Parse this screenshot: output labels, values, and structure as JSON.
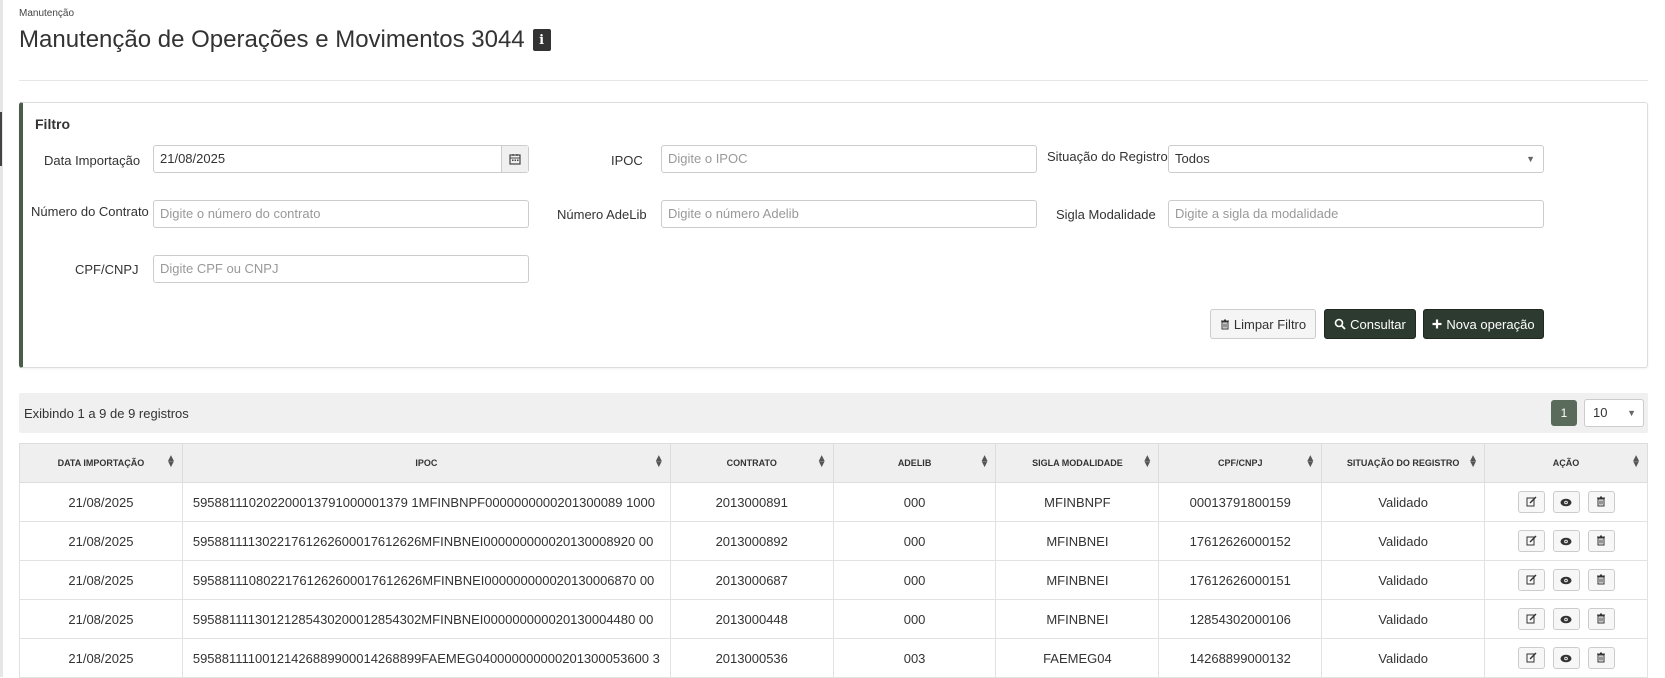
{
  "breadcrumb": "Manutenção",
  "title": "Manutenção de Operações e Movimentos 3044",
  "filter": {
    "heading": "Filtro",
    "data_importacao": {
      "label": "Data Importação",
      "value": "21/08/2025"
    },
    "ipoc": {
      "label": "IPOC",
      "placeholder": "Digite o IPOC"
    },
    "situacao": {
      "label": "Situação do Registro",
      "value": "Todos"
    },
    "numero_contrato": {
      "label": "Número do Contrato",
      "placeholder": "Digite o número do contrato"
    },
    "numero_adelib": {
      "label": "Número AdeLib",
      "placeholder": "Digite o número Adelib"
    },
    "sigla_modalidade": {
      "label": "Sigla Modalidade",
      "placeholder": "Digite a sigla da modalidade"
    },
    "cpf_cnpj": {
      "label": "CPF/CNPJ",
      "placeholder": "Digite CPF ou CNPJ"
    },
    "buttons": {
      "limpar": "Limpar Filtro",
      "consultar": "Consultar",
      "nova": "Nova operação"
    }
  },
  "results": {
    "summary": "Exibindo 1 a 9 de 9 registros",
    "page": "1",
    "page_size": "10"
  },
  "table": {
    "headers": [
      "DATA IMPORTAÇÃO",
      "IPOC",
      "CONTRATO",
      "ADELIB",
      "SIGLA MODALIDADE",
      "CPF/CNPJ",
      "SITUAÇÃO DO REGISTRO",
      "AÇÃO"
    ],
    "rows": [
      [
        "21/08/2025",
        "595881110202200013791000001379 1MFINBNPF0000000000201300089 1000",
        "2013000891",
        "000",
        "MFINBNPF",
        "00013791800159",
        "Validado"
      ],
      [
        "21/08/2025",
        "59588111130221761262600017612626MFINBNEI000000000020130008920 00",
        "2013000892",
        "000",
        "MFINBNEI",
        "17612626000152",
        "Validado"
      ],
      [
        "21/08/2025",
        "59588111080221761262600017612626MFINBNEI000000000020130006870 00",
        "2013000687",
        "000",
        "MFINBNEI",
        "17612626000151",
        "Validado"
      ],
      [
        "21/08/2025",
        "59588111130121285430200012854302MFINBNEI000000000020130004480 00",
        "2013000448",
        "000",
        "MFINBNEI",
        "12854302000106",
        "Validado"
      ],
      [
        "21/08/2025",
        "59588111100121426889900014268899FAEMEG040000000000201300053600 3",
        "2013000536",
        "003",
        "FAEMEG04",
        "14268899000132",
        "Validado"
      ]
    ]
  }
}
